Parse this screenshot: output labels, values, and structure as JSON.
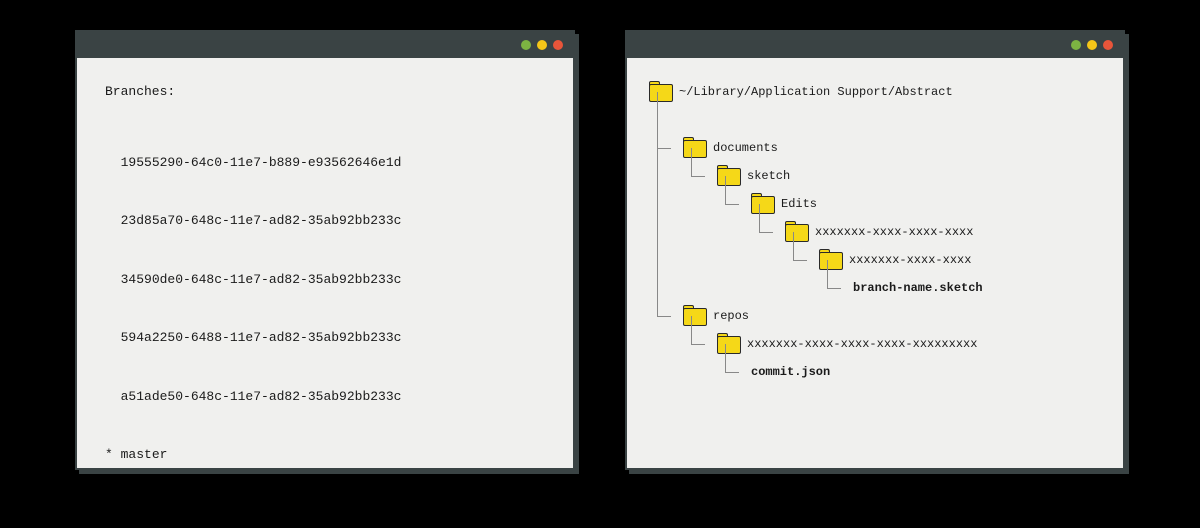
{
  "left": {
    "heading": "Branches:",
    "branches": [
      {
        "name": "19555290-64c0-11e7-b889-e93562646e1d",
        "active": false
      },
      {
        "name": "23d85a70-648c-11e7-ad82-35ab92bb233c",
        "active": false
      },
      {
        "name": "34590de0-648c-11e7-ad82-35ab92bb233c",
        "active": false
      },
      {
        "name": "594a2250-6488-11e7-ad82-35ab92bb233c",
        "active": false
      },
      {
        "name": "a51ade50-648c-11e7-ad82-35ab92bb233c",
        "active": false
      },
      {
        "name": "master",
        "active": true
      }
    ]
  },
  "right": {
    "root": "~/Library/Application Support/Abstract",
    "documents": "documents",
    "sketch": "sketch",
    "edits": "Edits",
    "uuid1": "xxxxxxx-xxxx-xxxx-xxxx",
    "uuid2": "xxxxxxx-xxxx-xxxx",
    "sketchfile": "branch-name.sketch",
    "repos": "repos",
    "repouuid": "xxxxxxx-xxxx-xxxx-xxxx-xxxxxxxxx",
    "commitjson": "commit.json"
  },
  "colors": {
    "folder": "#f5d818",
    "titlebar": "#3a4344",
    "bg": "#f0f0ee"
  }
}
